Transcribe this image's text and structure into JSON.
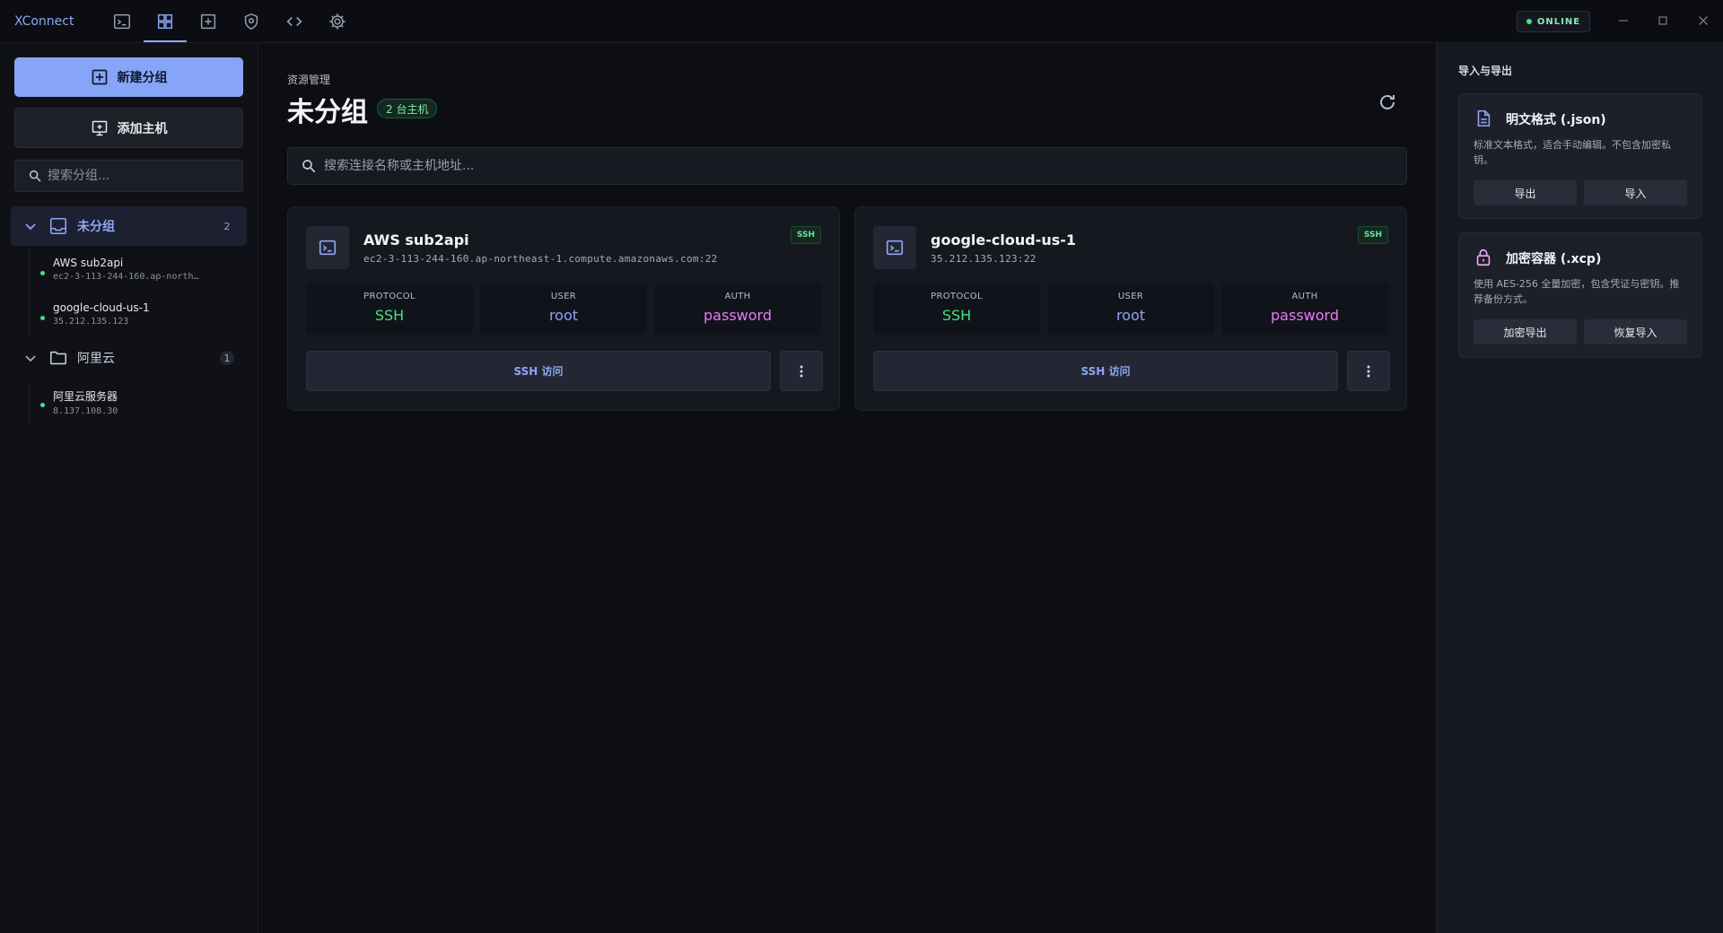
{
  "app": {
    "title": "XConnect",
    "status": "ONLINE",
    "toolbar": [
      "terminal-icon",
      "grid-icon",
      "add-box-icon",
      "shield-icon",
      "code-icon",
      "gear-icon"
    ]
  },
  "sidebar": {
    "new_group_label": "新建分组",
    "add_host_label": "添加主机",
    "search_placeholder": "搜索分组...",
    "groups": [
      {
        "name": "未分组",
        "count": "2",
        "hosts": [
          {
            "name": "AWS sub2api",
            "address": "ec2-3-113-244-160.ap-northeast-1.compute.amazonaws.com:22"
          },
          {
            "name": "google-cloud-us-1",
            "address": "35.212.135.123"
          }
        ]
      },
      {
        "name": "阿里云",
        "count": "1",
        "hosts": [
          {
            "name": "阿里云服务器",
            "address": "8.137.108.30"
          }
        ]
      }
    ]
  },
  "main": {
    "breadcrumb": "资源管理",
    "title": "未分组",
    "host_count_badge": "2 台主机",
    "search_placeholder": "搜索连接名称或主机地址...",
    "cards": [
      {
        "name": "AWS sub2api",
        "address": "ec2-3-113-244-160.ap-northeast-1.compute.amazonaws.com:22",
        "tag": "SSH",
        "protocol_label": "PROTOCOL",
        "protocol": "SSH",
        "user_label": "USER",
        "user": "root",
        "auth_label": "AUTH",
        "auth": "password",
        "access_label": "SSH 访问"
      },
      {
        "name": "google-cloud-us-1",
        "address": "35.212.135.123:22",
        "tag": "SSH",
        "protocol_label": "PROTOCOL",
        "protocol": "SSH",
        "user_label": "USER",
        "user": "root",
        "auth_label": "AUTH",
        "auth": "password",
        "access_label": "SSH 访问"
      }
    ]
  },
  "right_panel": {
    "title": "导入与导出",
    "plain": {
      "name": "明文格式 (.json)",
      "description": "标准文本格式，适合手动编辑。不包含加密私钥。",
      "export_label": "导出",
      "import_label": "导入"
    },
    "encrypted": {
      "name": "加密容器 (.xcp)",
      "description": "使用 AES-256 全量加密，包含凭证与密钥。推荐备份方式。",
      "export_label": "加密导出",
      "import_label": "恢复导入"
    }
  },
  "colors": {
    "accent": "#86a5f6",
    "protocol": "#4ade80",
    "user": "#8ea6f5",
    "auth": "#e879f9",
    "online": "#4ade80",
    "lock": "#f0a6f0"
  }
}
